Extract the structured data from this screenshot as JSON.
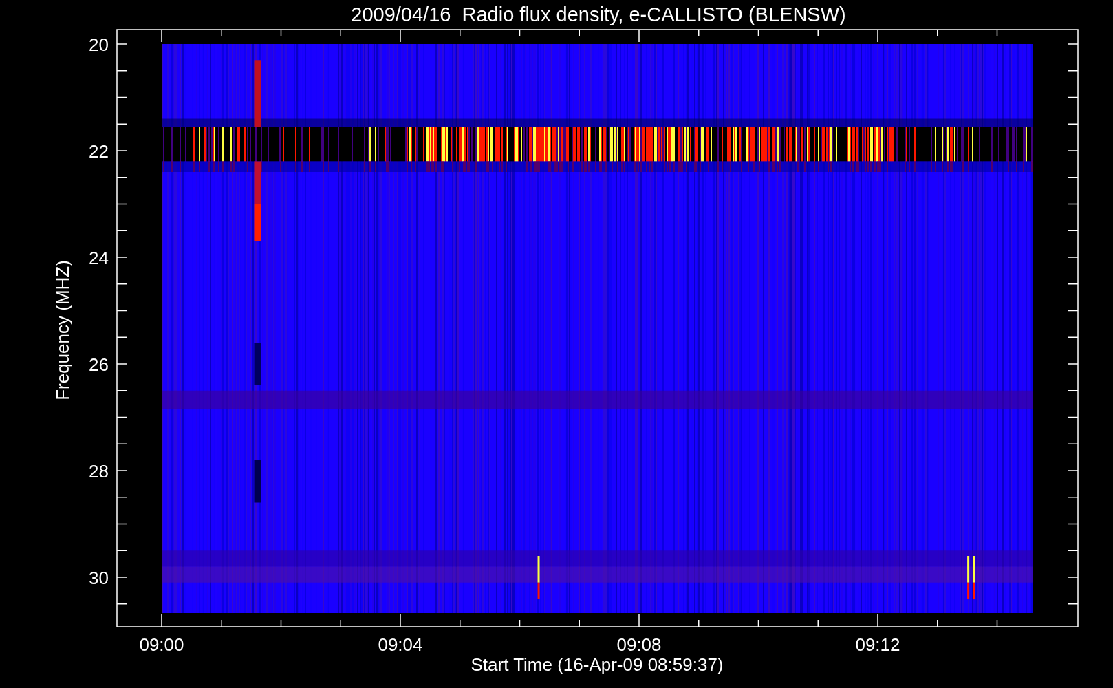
{
  "title": "2009/04/16  Radio flux density, e-CALLISTO (BLENSW)",
  "y_axis": {
    "label": "Frequency (MHZ)",
    "ticks": [
      "20",
      "22",
      "24",
      "26",
      "28",
      "30"
    ]
  },
  "x_axis": {
    "label": "Start Time (16-Apr-09 08:59:37)",
    "ticks": [
      "09:00",
      "09:04",
      "09:08",
      "09:12"
    ]
  }
}
